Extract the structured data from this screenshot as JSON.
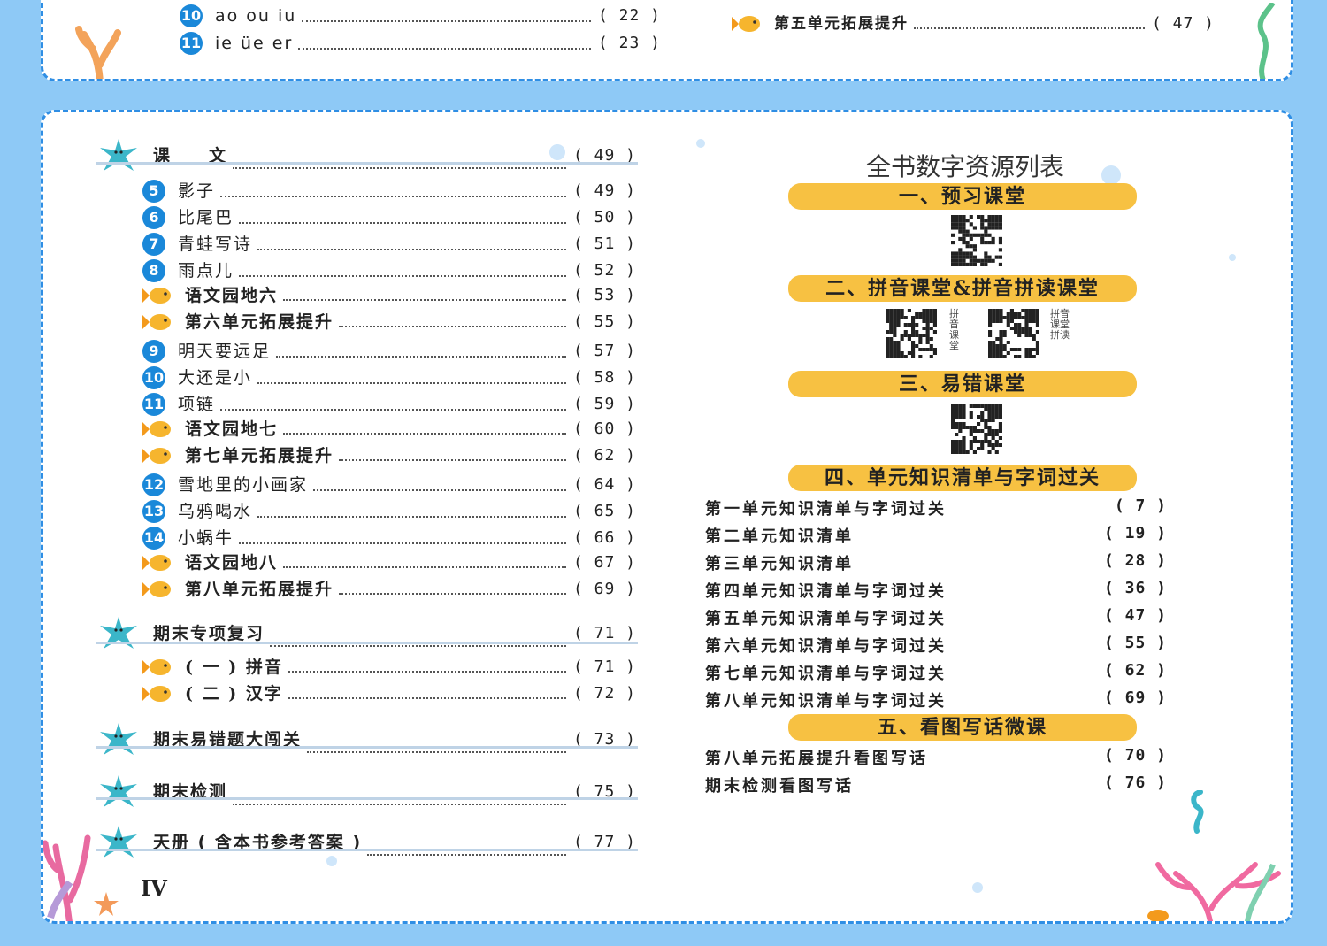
{
  "top": {
    "left_rows": [
      {
        "num": "10",
        "label": "ao ou iu",
        "page": "( 22 )"
      },
      {
        "num": "11",
        "label": "ie üe er",
        "page": "( 23 )"
      }
    ],
    "right_rows": [
      {
        "label": "第五单元拓展提升",
        "page": "( 47 )"
      }
    ]
  },
  "toc": {
    "rows": [
      {
        "kind": "star",
        "label": "课　　文",
        "page": "( 49 )"
      },
      {
        "kind": "num",
        "num": "5",
        "label": "影子",
        "page": "( 49 )"
      },
      {
        "kind": "num",
        "num": "6",
        "label": "比尾巴",
        "page": "( 50 )"
      },
      {
        "kind": "num",
        "num": "7",
        "label": "青蛙写诗",
        "page": "( 51 )"
      },
      {
        "kind": "num",
        "num": "8",
        "label": "雨点儿",
        "page": "( 52 )"
      },
      {
        "kind": "fish",
        "label": "语文园地六",
        "page": "( 53 )"
      },
      {
        "kind": "fish",
        "label": "第六单元拓展提升",
        "page": "( 55 )"
      },
      {
        "kind": "num",
        "num": "9",
        "label": "明天要远足",
        "page": "( 57 )"
      },
      {
        "kind": "num",
        "num": "10",
        "label": "大还是小",
        "page": "( 58 )"
      },
      {
        "kind": "num",
        "num": "11",
        "label": "项链",
        "page": "( 59 )"
      },
      {
        "kind": "fish",
        "label": "语文园地七",
        "page": "( 60 )"
      },
      {
        "kind": "fish",
        "label": "第七单元拓展提升",
        "page": "( 62 )"
      },
      {
        "kind": "num",
        "num": "12",
        "label": "雪地里的小画家",
        "page": "( 64 )"
      },
      {
        "kind": "num",
        "num": "13",
        "label": "乌鸦喝水",
        "page": "( 65 )"
      },
      {
        "kind": "num",
        "num": "14",
        "label": "小蜗牛",
        "page": "( 66 )"
      },
      {
        "kind": "fish",
        "label": "语文园地八",
        "page": "( 67 )"
      },
      {
        "kind": "fish",
        "label": "第八单元拓展提升",
        "page": "( 69 )"
      },
      {
        "kind": "star",
        "label": "期末专项复习",
        "page": "( 71 )"
      },
      {
        "kind": "fish",
        "label": "( 一 ) 拼音",
        "page": "( 71 )"
      },
      {
        "kind": "fish",
        "label": "( 二 ) 汉字",
        "page": "( 72 )"
      },
      {
        "kind": "star",
        "label": "期末易错题大闯关",
        "page": "( 73 )"
      },
      {
        "kind": "star",
        "label": "期末检测",
        "page": "( 75 )"
      },
      {
        "kind": "star",
        "label": "天册 ( 含本书参考答案 )",
        "page": "( 77 )"
      }
    ],
    "page_number": "IV"
  },
  "resources": {
    "title": "全书数字资源列表",
    "bands": [
      "一、预习课堂",
      "二、拼音课堂&拼音拼读课堂",
      "三、易错课堂",
      "四、单元知识清单与字词过关",
      "五、看图写话微课"
    ],
    "qr_captions": [
      "拼音课堂",
      "拼音课堂拼读"
    ],
    "unit_rows": [
      {
        "label": "第一单元知识清单与字词过关",
        "page": "( 7 )"
      },
      {
        "label": "第二单元知识清单",
        "page": "( 19 )"
      },
      {
        "label": "第三单元知识清单",
        "page": "( 28 )"
      },
      {
        "label": "第四单元知识清单与字词过关",
        "page": "( 36 )"
      },
      {
        "label": "第五单元知识清单与字词过关",
        "page": "( 47 )"
      },
      {
        "label": "第六单元知识清单与字词过关",
        "page": "( 55 )"
      },
      {
        "label": "第七单元知识清单与字词过关",
        "page": "( 62 )"
      },
      {
        "label": "第八单元知识清单与字词过关",
        "page": "( 69 )"
      }
    ],
    "writing_rows": [
      {
        "label": "第八单元拓展提升看图写话",
        "page": "( 70 )"
      },
      {
        "label": "期末检测看图写话",
        "page": "( 76 )"
      }
    ]
  },
  "colors": {
    "background": "#8ec9f6",
    "border": "#2f8ee4",
    "band": "#f7c142",
    "badge": "#1a88d9",
    "fish": "#f6b52e",
    "star": "#3bb6c9"
  }
}
